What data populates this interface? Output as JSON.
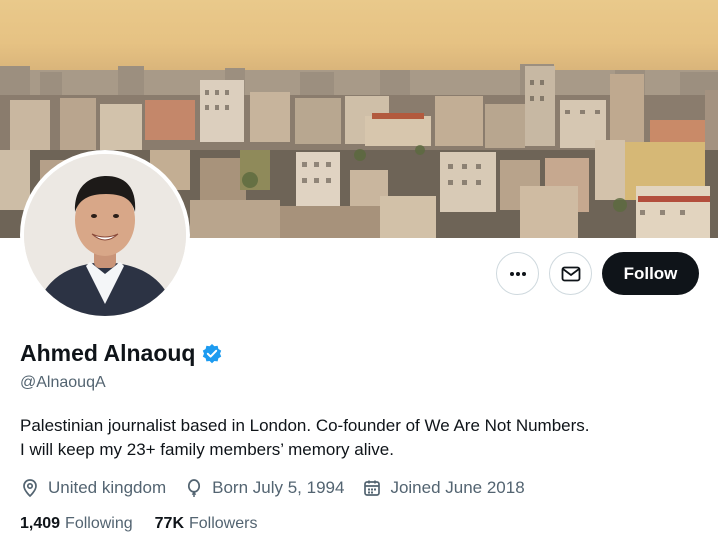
{
  "profile": {
    "display_name": "Ahmed Alnaouq",
    "handle": "@AlnaouqA",
    "verified_icon": "verified-badge-icon",
    "bio_line1": "Palestinian journalist based in London. Co-founder of We Are Not Numbers.",
    "bio_line2": "I will keep my 23+ family members’ memory alive."
  },
  "meta": {
    "location": "United kingdom",
    "birthday": "Born July 5, 1994",
    "joined": "Joined June 2018"
  },
  "stats": {
    "following_count": "1,409",
    "following_label": "Following",
    "followers_count": "77K",
    "followers_label": "Followers"
  },
  "actions": {
    "more_icon": "more-icon",
    "message_icon": "mail-icon",
    "follow_label": "Follow"
  },
  "colors": {
    "verified_blue": "#1d9bf0",
    "follow_button_bg": "#0f1419",
    "secondary_text": "#536471"
  }
}
